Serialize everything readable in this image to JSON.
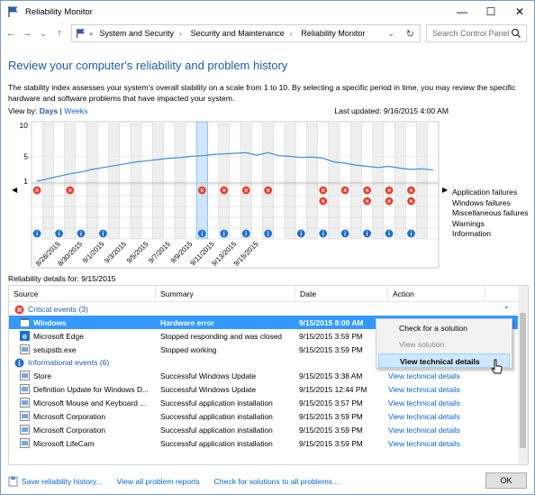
{
  "window": {
    "title": "Reliability Monitor"
  },
  "nav": {
    "back": "←",
    "forward": "→",
    "up": "↑",
    "chevron": "«",
    "breadcrumbs": [
      "System and Security",
      "Security and Maintenance",
      "Reliability Monitor"
    ],
    "search_placeholder": "Search Control Panel"
  },
  "page": {
    "heading": "Review your computer's reliability and problem history",
    "description": "The stability index assesses your system's overall stability on a scale from 1 to 10. By selecting a specific period in time, you may review the specific hardware and software problems that have impacted your system.",
    "view_by_label": "View by:",
    "view_days": "Days",
    "view_sep": "|",
    "view_weeks": "Weeks",
    "last_updated": "Last updated: 9/16/2015 4:00 AM"
  },
  "chart_data": {
    "type": "line",
    "y_ticks": [
      "10",
      "5",
      "1"
    ],
    "ylim": [
      1,
      10
    ],
    "x_labels": [
      "8/28/2015",
      "8/30/2015",
      "9/1/2015",
      "9/3/2015",
      "9/5/2015",
      "9/7/2015",
      "9/9/2015",
      "9/11/2015",
      "9/13/2015",
      "9/15/2015"
    ],
    "stability_index": [
      1.0,
      1.4,
      1.8,
      2.2,
      2.5,
      2.9,
      3.2,
      3.5,
      3.8,
      4.1,
      4.3,
      4.5,
      4.7,
      4.8,
      5.0,
      5.1,
      5.3,
      5.4,
      5.5,
      5.6,
      5.2,
      5.6,
      5.1,
      5.0,
      4.8,
      4.9,
      4.7,
      4.1,
      3.9,
      3.6,
      3.4,
      3.2,
      3.4,
      3.1,
      2.9,
      3.0,
      2.8
    ],
    "selected_column": 15,
    "rows": {
      "application_failures": [
        0,
        3,
        15,
        17,
        19,
        21,
        26,
        28,
        30,
        32,
        34
      ],
      "windows_failures": [
        26,
        30,
        32,
        34
      ],
      "misc_failures": [],
      "warnings": [],
      "information": [
        0,
        2,
        4,
        6,
        15,
        17,
        19,
        21,
        24,
        26,
        28,
        30,
        32,
        34
      ]
    },
    "legend": [
      "Application failures",
      "Windows failures",
      "Miscellaneous failures",
      "Warnings",
      "Information"
    ]
  },
  "details": {
    "label": "Reliability details for: 9/15/2015",
    "columns": [
      "Source",
      "Summary",
      "Date",
      "Action"
    ],
    "critical_group": "Critical events (3)",
    "info_group": "Informational events (6)",
    "critical": [
      {
        "source": "Windows",
        "summary": "Hardware error",
        "date": "9/15/2015 8:00 AM",
        "action": ""
      },
      {
        "source": "Microsoft Edge",
        "summary": "Stopped responding and was closed",
        "date": "9/15/2015 3:59 PM",
        "action": ""
      },
      {
        "source": "setupstb.exe",
        "summary": "Stopped working",
        "date": "9/15/2015 3:59 PM",
        "action": ""
      }
    ],
    "info": [
      {
        "source": "Store",
        "summary": "Successful Windows Update",
        "date": "9/15/2015 3:38 AM",
        "action": "View  technical details"
      },
      {
        "source": "Definition Update for Windows D...",
        "summary": "Successful Windows Update",
        "date": "9/15/2015 12:44 PM",
        "action": "View  technical details"
      },
      {
        "source": "Microsoft Mouse and Keyboard ...",
        "summary": "Successful application installation",
        "date": "9/15/2015 3:57 PM",
        "action": "View  technical details"
      },
      {
        "source": "Microsoft Corporation",
        "summary": "Successful application installation",
        "date": "9/15/2015 3:59 PM",
        "action": "View  technical details"
      },
      {
        "source": "Microsoft Corporation",
        "summary": "Successful application installation",
        "date": "9/15/2015 3:59 PM",
        "action": "View  technical details"
      },
      {
        "source": "Microsoft LifeCam",
        "summary": "Successful application installation",
        "date": "9/15/2015 3:59 PM",
        "action": "View  technical details"
      }
    ]
  },
  "context_menu": {
    "items": [
      "Check for a solution",
      "View solution",
      "View technical details"
    ]
  },
  "footer": {
    "save": "Save reliability history...",
    "all_reports": "View all problem reports",
    "check_all": "Check for solutions to all problems ...",
    "ok": "OK"
  },
  "colors": {
    "accent": "#1e5aa6",
    "link": "#0066cc",
    "error": "#e8402e",
    "info": "#1e6fd0",
    "line": "#3b8fd9",
    "selected": "#cfe6fb"
  }
}
